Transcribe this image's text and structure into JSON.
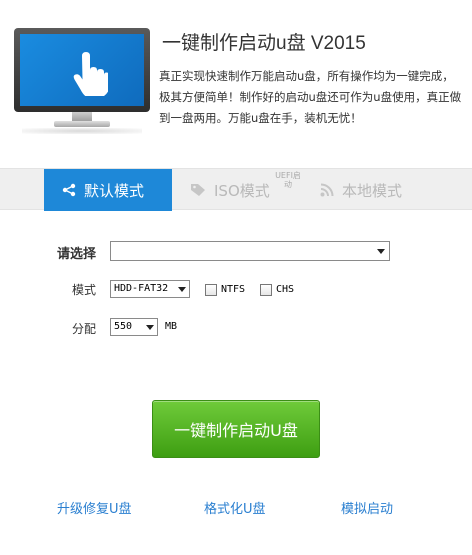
{
  "header": {
    "title": "一键制作启动u盘 V2015",
    "description": "真正实现快速制作万能启动u盘，所有操作均为一键完成，极其方便简单！制作好的启动u盘还可作为u盘使用，真正做到一盘两用。万能u盘在手，装机无忧！"
  },
  "tabs": {
    "default_mode": "默认模式",
    "iso_mode": "ISO模式",
    "uefi_badge": "UEFI启动",
    "local_mode": "本地模式"
  },
  "form": {
    "select_label": "请选择",
    "select_value": "",
    "mode_label": "模式",
    "mode_value": "HDD-FAT32",
    "ntfs_label": "NTFS",
    "chs_label": "CHS",
    "partition_label": "分配",
    "partition_value": "550",
    "partition_unit": "MB"
  },
  "actions": {
    "make_button": "一键制作启动U盘"
  },
  "links": {
    "upgrade": "升级修复U盘",
    "format": "格式化U盘",
    "simulate": "模拟启动"
  },
  "colors": {
    "accent": "#1e88d8",
    "button_green": "#4fb322",
    "link_blue": "#2a7fd0"
  }
}
